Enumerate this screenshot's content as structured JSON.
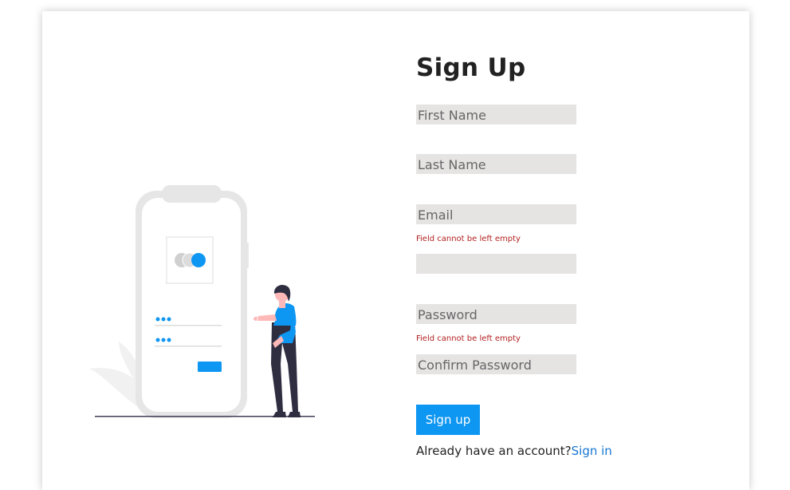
{
  "signup_form": {
    "title": "Sign Up",
    "fields": {
      "first_name": {
        "placeholder": "First Name",
        "value": ""
      },
      "last_name": {
        "placeholder": "Last Name",
        "value": ""
      },
      "email": {
        "placeholder": "Email",
        "value": ""
      },
      "unlabeled": {
        "placeholder": "",
        "value": ""
      },
      "password": {
        "placeholder": "Password",
        "value": ""
      },
      "confirm_password": {
        "placeholder": "Confirm Password",
        "value": ""
      }
    },
    "errors": {
      "email": "Field cannot be left empty",
      "password": "Field cannot be left empty"
    },
    "submit_label": "Sign up",
    "signin_prompt": "Already have an account?",
    "signin_link": "Sign in"
  },
  "colors": {
    "primary": "#0d96f2",
    "link": "#1877d2",
    "error": "#b32020",
    "field_background": "#e6e3e3",
    "illustration_blue": "#0d96f2"
  },
  "illustration": {
    "icons": [
      "phone-icon",
      "card-logo-icon",
      "person-icon",
      "leaf-icon"
    ]
  }
}
